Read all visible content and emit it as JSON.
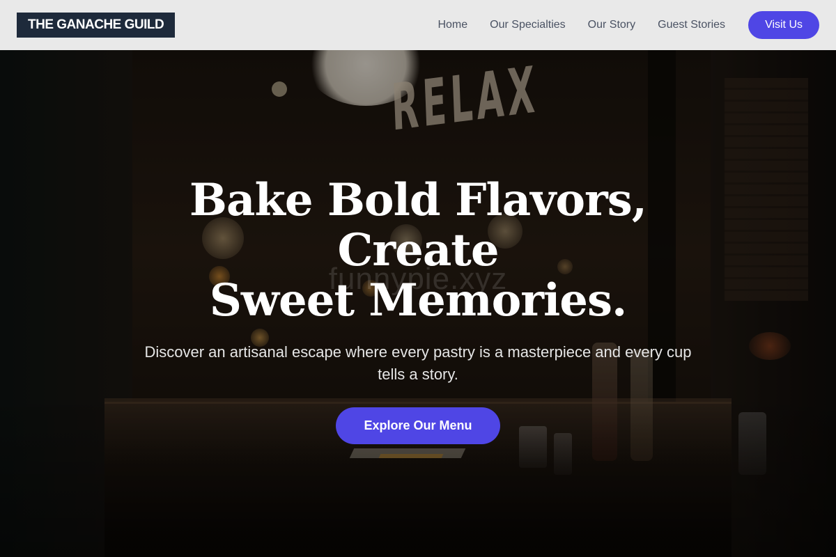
{
  "header": {
    "brand": "THE GANACHE GUILD",
    "nav": [
      {
        "label": "Home"
      },
      {
        "label": "Our Specialties"
      },
      {
        "label": "Our Story"
      },
      {
        "label": "Guest Stories"
      }
    ],
    "cta_label": "Visit Us"
  },
  "hero": {
    "background_sign_text": "RELAX",
    "title_line1": "Bake Bold Flavors, Create",
    "title_line2": "Sweet Memories.",
    "watermark": "funnypie.xyz",
    "subtitle": "Discover an artisanal escape where every pastry is a masterpiece and every cup tells a story.",
    "cta_label": "Explore Our Menu"
  },
  "colors": {
    "accent": "#4f46e5",
    "logo_background": "#1e2a3b",
    "header_background": "#f2f2f2",
    "nav_text": "#4a5263"
  }
}
